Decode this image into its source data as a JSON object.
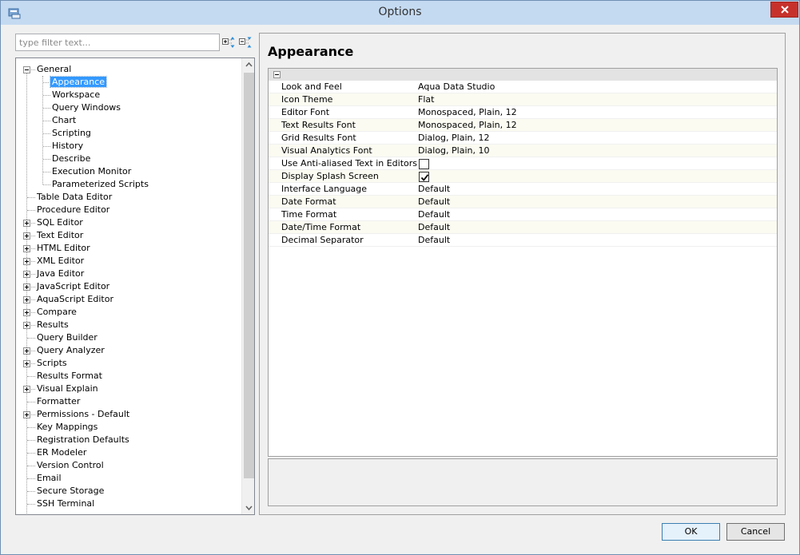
{
  "window": {
    "title": "Options"
  },
  "filter": {
    "placeholder": "type filter text..."
  },
  "tree": {
    "rows": [
      {
        "label": "General",
        "level": 0,
        "expander": "minus"
      },
      {
        "label": "Appearance",
        "level": 1,
        "selected": true
      },
      {
        "label": "Workspace",
        "level": 1
      },
      {
        "label": "Query Windows",
        "level": 1
      },
      {
        "label": "Chart",
        "level": 1
      },
      {
        "label": "Scripting",
        "level": 1
      },
      {
        "label": "History",
        "level": 1
      },
      {
        "label": "Describe",
        "level": 1
      },
      {
        "label": "Execution Monitor",
        "level": 1
      },
      {
        "label": "Parameterized Scripts",
        "level": 1
      },
      {
        "label": "Table Data Editor",
        "level": 0
      },
      {
        "label": "Procedure Editor",
        "level": 0
      },
      {
        "label": "SQL Editor",
        "level": 0,
        "expander": "plus"
      },
      {
        "label": "Text Editor",
        "level": 0,
        "expander": "plus"
      },
      {
        "label": "HTML Editor",
        "level": 0,
        "expander": "plus"
      },
      {
        "label": "XML Editor",
        "level": 0,
        "expander": "plus"
      },
      {
        "label": "Java Editor",
        "level": 0,
        "expander": "plus"
      },
      {
        "label": "JavaScript Editor",
        "level": 0,
        "expander": "plus"
      },
      {
        "label": "AquaScript Editor",
        "level": 0,
        "expander": "plus"
      },
      {
        "label": "Compare",
        "level": 0,
        "expander": "plus"
      },
      {
        "label": "Results",
        "level": 0,
        "expander": "plus"
      },
      {
        "label": "Query Builder",
        "level": 0
      },
      {
        "label": "Query Analyzer",
        "level": 0,
        "expander": "plus"
      },
      {
        "label": "Scripts",
        "level": 0,
        "expander": "plus"
      },
      {
        "label": "Results Format",
        "level": 0
      },
      {
        "label": "Visual Explain",
        "level": 0,
        "expander": "plus"
      },
      {
        "label": "Formatter",
        "level": 0
      },
      {
        "label": "Permissions - Default",
        "level": 0,
        "expander": "plus"
      },
      {
        "label": "Key Mappings",
        "level": 0
      },
      {
        "label": "Registration Defaults",
        "level": 0
      },
      {
        "label": "ER Modeler",
        "level": 0
      },
      {
        "label": "Version Control",
        "level": 0
      },
      {
        "label": "Email",
        "level": 0
      },
      {
        "label": "Secure Storage",
        "level": 0
      },
      {
        "label": "SSH Terminal",
        "level": 0
      }
    ]
  },
  "panel": {
    "title": "Appearance",
    "properties": [
      {
        "name": "Look and Feel",
        "value": "Aqua Data Studio"
      },
      {
        "name": "Icon Theme",
        "value": "Flat"
      },
      {
        "name": "Editor Font",
        "value": "Monospaced, Plain, 12"
      },
      {
        "name": "Text Results Font",
        "value": "Monospaced, Plain, 12"
      },
      {
        "name": "Grid Results Font",
        "value": "Dialog, Plain, 12"
      },
      {
        "name": "Visual Analytics Font",
        "value": "Dialog, Plain, 10"
      },
      {
        "name": "Use Anti-aliased Text in Editors",
        "checkbox": true,
        "checked": false
      },
      {
        "name": "Display Splash Screen",
        "checkbox": true,
        "checked": true
      },
      {
        "name": "Interface Language",
        "value": "Default"
      },
      {
        "name": "Date Format",
        "value": "Default"
      },
      {
        "name": "Time Format",
        "value": "Default"
      },
      {
        "name": "Date/Time Format",
        "value": "Default"
      },
      {
        "name": "Decimal Separator",
        "value": "Default"
      }
    ]
  },
  "buttons": {
    "ok": "OK",
    "cancel": "Cancel"
  },
  "colors": {
    "selection": "#3399ff",
    "close": "#c7312b",
    "titlebar": "#c4daf1"
  }
}
